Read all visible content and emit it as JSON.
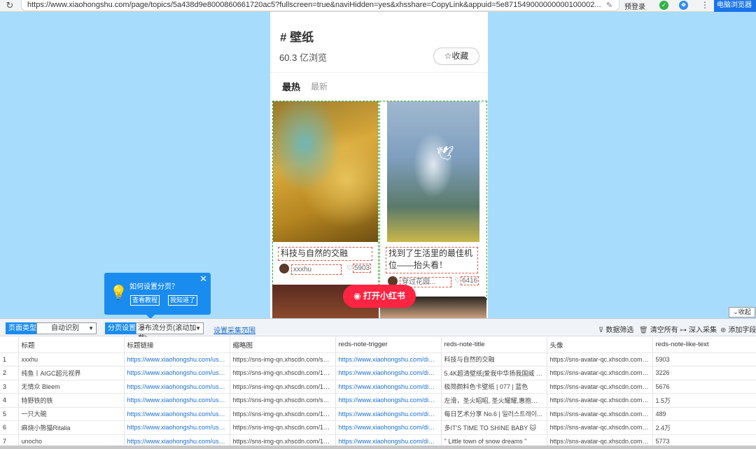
{
  "browser": {
    "url": "https://www.xiaohongshu.com/page/topics/5a438d9e8000860661720ac5?fullscreen=true&naviHidden=yes&xhsshare=CopyLink&appuid=5e871549000000000100002...",
    "login_label": "预登录",
    "pc_browser_label": "电脑浏览器",
    "icons": {
      "reload": "reload-icon",
      "edit": "pen-icon",
      "menu": "kebab-icon"
    }
  },
  "topic": {
    "title": "# 壁纸",
    "views_number": "60.3",
    "views_unit": "亿浏览",
    "favorite_label": "收藏",
    "tabs": [
      "最热",
      "最新"
    ],
    "open_app_label": "打开小红书"
  },
  "notes": [
    {
      "title": "科技与自然的交融",
      "author": "xxxhu",
      "likes": "5903"
    },
    {
      "title": "找到了生活里的最佳机位——抬头看！",
      "author": "穿过花园...",
      "likes": "6416"
    }
  ],
  "tooltip": {
    "title": "如何设置分页？",
    "btn_tutorial": "查看教程",
    "btn_got_it": "我知道了"
  },
  "collapse_label": "收起",
  "toolbar": {
    "page_type_label": "页面类型",
    "page_type_value": "自动识别",
    "paging_label": "分页设置",
    "paging_value": "瀑布流分页(滚动加载)",
    "range_link": "设置采集范围",
    "filter": "数据筛选",
    "clear": "清空所有",
    "deep": "深入采集",
    "add_field": "添加字段"
  },
  "table": {
    "columns": [
      "",
      "标题",
      "标题链接",
      "缩略图",
      "reds-note-trigger",
      "reds-note-title",
      "头像",
      "reds-note-like-text"
    ],
    "rows": [
      [
        "1",
        "xxxhu",
        "https://www.xiaohongshu.com/user/...",
        "https://sns-img-qn.xhscdn.com/spect...",
        "https://www.xiaohongshu.com/disco...",
        "科技与自然的交融",
        "https://sns-avatar-qc.xhscdn.com/av...",
        "5903"
      ],
      [
        "2",
        "纯鱼丨AIGC超元视界",
        "https://www.xiaohongshu.com/user/...",
        "https://sns-img-qn.xhscdn.com/1040...",
        "https://www.xiaohongshu.com/disco...",
        "5.4K超清壁纸|爱我中华扬我国威 | 国...",
        "https://sns-avatar-qc.xhscdn.com/av...",
        "3226"
      ],
      [
        "3",
        "无情众 Bleem",
        "https://www.xiaohongshu.com/user/...",
        "https://sns-img-qn.xhscdn.com/1040...",
        "https://www.xiaohongshu.com/disco...",
        "极简颜料色卡壁纸 | 077 | 蓝色",
        "https://sns-avatar-qc.xhscdn.com/av...",
        "5676"
      ],
      [
        "4",
        "特野铁的铁",
        "https://www.xiaohongshu.com/user/...",
        "https://sns-img-qn.xhscdn.com/spect...",
        "https://www.xiaohongshu.com/disco...",
        "左滑，圣火昭昭, 圣火耀耀,惠抱脾瓷...",
        "https://sns-avatar-qc.xhscdn.com/av...",
        "1.5万"
      ],
      [
        "5",
        "一只大碗",
        "https://www.xiaohongshu.com/user/...",
        "https://sns-img-qn.xhscdn.com/1040...",
        "https://www.xiaohongshu.com/disco...",
        "每日艺术分享 No.6 | 일러스트레이...",
        "https://sns-avatar-qc.xhscdn.com/av...",
        "489"
      ],
      [
        "6",
        "麻烧小熊猫Ritalia",
        "https://www.xiaohongshu.com/user/...",
        "https://sns-img-qn.xhscdn.com/1000...",
        "https://www.xiaohongshu.com/disco...",
        "多IT'S TIME TO SHINE BABY 🐱",
        "https://sns-avatar-qc.xhscdn.com/av...",
        "2.4万"
      ],
      [
        "7",
        "unocho",
        "https://www.xiaohongshu.com/user/...",
        "https://sns-img-qn.xhscdn.com/1040...",
        "https://www.xiaohongshu.com/disco...",
        "\" Little town of snow dreams \"",
        "https://sns-avatar-qc.xhscdn.com/av...",
        "5773"
      ]
    ]
  },
  "colors": {
    "page_bg": "#a8dcfc",
    "brand_red": "#ff2442",
    "accent_blue": "#1a8cf0",
    "dashed_red": "#e2534a",
    "dashed_green": "#2e9e2e"
  }
}
